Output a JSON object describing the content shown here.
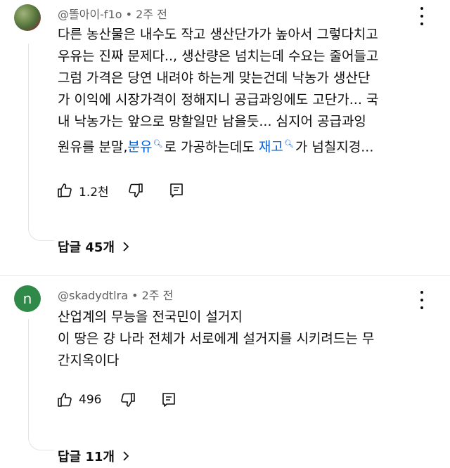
{
  "comments": [
    {
      "author": "@똘아이-f1o",
      "time": "2주 전",
      "avatar_letter": "",
      "body": {
        "line1": "다른 농산물은 내수도 작고 생산단가가 높아서 그렇다치고",
        "line2": "우유는 진짜 문제다.., 생산량은 넘치는데 수요는 줄어들고",
        "line3": "그럼 가격은 당연 내려야 하는게 맞는건데 낙농가 생산단",
        "line4": "가 이익에 시장가격이 정해지니 공급과잉에도 고단가... 국",
        "line5": "내 낙농가는 앞으로 망할일만 남을듯... 심지어 공급과잉",
        "line6_a": "원유를 분말,",
        "line6_link1": "분유",
        "line6_b": "로 가공하는데도",
        "line6_link2": "재고",
        "line6_c": "가 넘칠지경..."
      },
      "likes": "1.2천",
      "replies_label": "답글 45개"
    },
    {
      "author": "@skadydtlra",
      "time": "2주 전",
      "avatar_letter": "n",
      "body": {
        "line1": "산업계의 무능을 전국민이 설거지",
        "line2": "이 땅은 걍 나라 전체가 서로에게 설거지를 시키려드는 무",
        "line3": "간지옥이다"
      },
      "likes": "496",
      "replies_label": "답글 11개"
    }
  ],
  "separator": " • ",
  "icons": {
    "search": "search-icon",
    "like": "thumbs-up-icon",
    "dislike": "thumbs-down-icon",
    "reply": "reply-icon",
    "more": "more-vert-icon",
    "chevron": "chevron-right-icon"
  },
  "colors": {
    "link": "#065fd4",
    "meta": "#606060",
    "avatar_green": "#2f8a4a"
  }
}
